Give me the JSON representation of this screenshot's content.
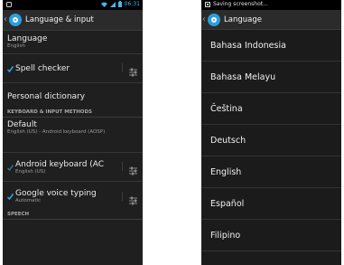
{
  "left": {
    "status": {
      "time": "06:31"
    },
    "title": "Language & input",
    "language": {
      "label": "Language",
      "value": "English"
    },
    "spell_checker": {
      "label": "Spell checker"
    },
    "personal_dictionary": {
      "label": "Personal dictionary"
    },
    "section_keyboard": "KEYBOARD & INPUT METHODS",
    "default": {
      "label": "Default",
      "value": "English (US) - Android keyboard (AOSP)"
    },
    "android_keyboard": {
      "label": "Android keyboard (AC",
      "value": "English (US)"
    },
    "google_voice": {
      "label": "Google voice typing",
      "value": "Automatic"
    },
    "section_speech": "SPEECH"
  },
  "right": {
    "status": {
      "text": "Saving screenshot..."
    },
    "title": "Language",
    "languages": [
      "Bahasa Indonesia",
      "Bahasa Melayu",
      "Čeština",
      "Deutsch",
      "English",
      "Español",
      "Filipino"
    ]
  },
  "colors": {
    "accent": "#2aa0de",
    "time": "#4fb3e8",
    "background": "#1f1f1f"
  }
}
